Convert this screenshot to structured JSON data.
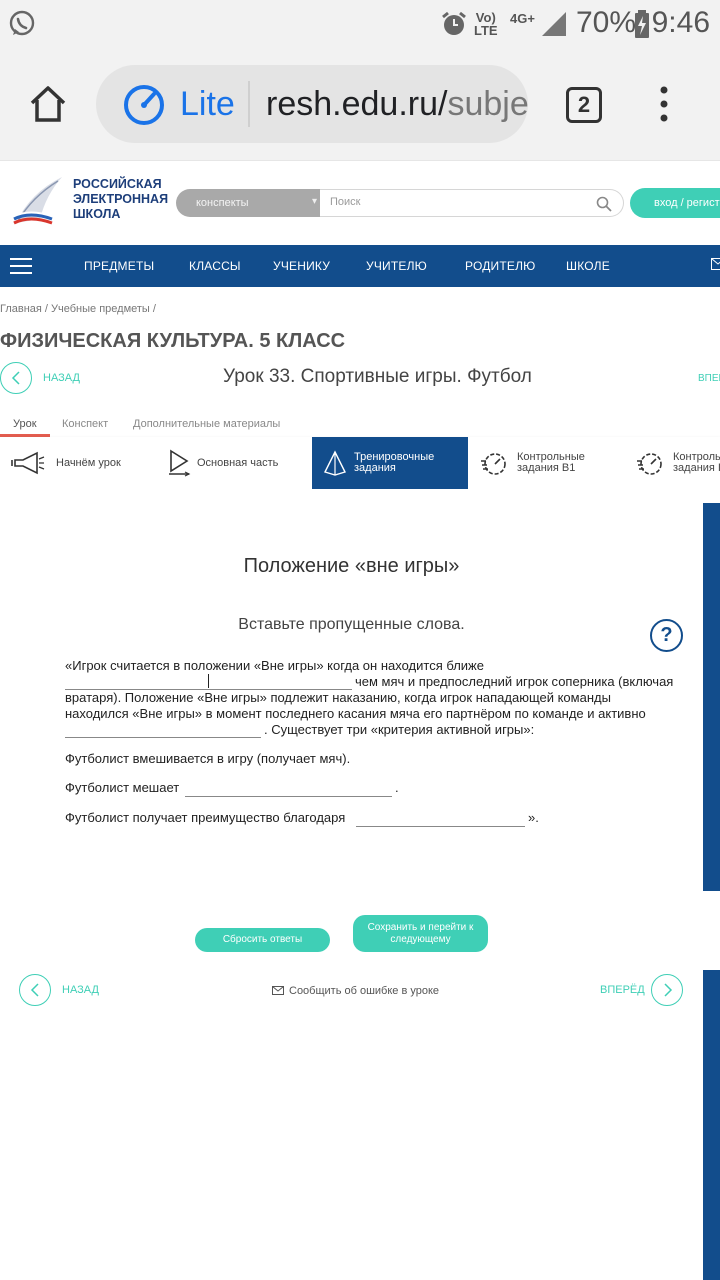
{
  "status_bar": {
    "network_line1": "Vo)",
    "network_line2": "LTE",
    "network_type": "4G+",
    "battery_percent": "70%",
    "time": "9:46"
  },
  "browser": {
    "lite_label": "Lite",
    "url_main": "resh.edu.ru/",
    "url_rest": "subje",
    "tab_count": "2"
  },
  "site": {
    "logo_line1": "РОССИЙСКАЯ",
    "logo_line2": "ЭЛЕКТРОННАЯ",
    "logo_line3": "ШКОЛА",
    "category_select": "конспекты",
    "search_placeholder": "Поиск",
    "login_button": "вход / регистр",
    "nav": [
      "ПРЕДМЕТЫ",
      "КЛАССЫ",
      "УЧЕНИКУ",
      "УЧИТЕЛЮ",
      "РОДИТЕЛЮ",
      "ШКОЛЕ"
    ]
  },
  "page": {
    "breadcrumb": "Главная  /  Учебные предметы  /",
    "course_title": "ФИЗИЧЕСКАЯ КУЛЬТУРА. 5 КЛАСС",
    "back_label": "НАЗАД",
    "lesson_title": "Урок 33. Спортивные игры. Футбол",
    "next_label_top": "ВПЕР",
    "tabs": [
      "Урок",
      "Конспект",
      "Дополнительные материалы"
    ],
    "sections": [
      {
        "line1": "Начнём урок",
        "line2": ""
      },
      {
        "line1": "Основная часть",
        "line2": ""
      },
      {
        "line1": "Тренировочные",
        "line2": "задания"
      },
      {
        "line1": "Контрольные",
        "line2": "задания В1"
      },
      {
        "line1": "Контроль",
        "line2": "задания I"
      }
    ]
  },
  "task": {
    "title": "Положение «вне игры»",
    "instruction": "Вставьте пропущенные слова.",
    "help": "?",
    "p1_line1": "«Игрок считается в положении «Вне игры» когда он находится ближе",
    "p1_line2_tail": "чем мяч и предпоследний игрок соперника (включая",
    "p1_line3": "вратаря). Положение «Вне игры» подлежит наказанию, когда игрок нападающей команды",
    "p1_line4": "находился «Вне игры» в момент последнего касания мяча его партнёром по команде и активно",
    "p1_line5_tail": ". Существует три «критерия активной игры»:",
    "p2": "Футболист вмешивается в игру (получает мяч).",
    "p3_head": "Футболист мешает",
    "p3_tail": ".",
    "p4_head": "Футболист получает преимущество благодаря",
    "p4_tail": "».",
    "reset_button": "Сбросить ответы",
    "save_button_line1": "Сохранить и перейти к",
    "save_button_line2": "следующему"
  },
  "footer_nav": {
    "back_label": "НАЗАД",
    "report_error": "Сообщить об ошибке в уроке",
    "next_label": "ВПЕРЁД"
  },
  "colors": {
    "brand_blue": "#124d8c",
    "accent_green": "#3fcfb6",
    "tab_underline": "#e35d4f"
  }
}
